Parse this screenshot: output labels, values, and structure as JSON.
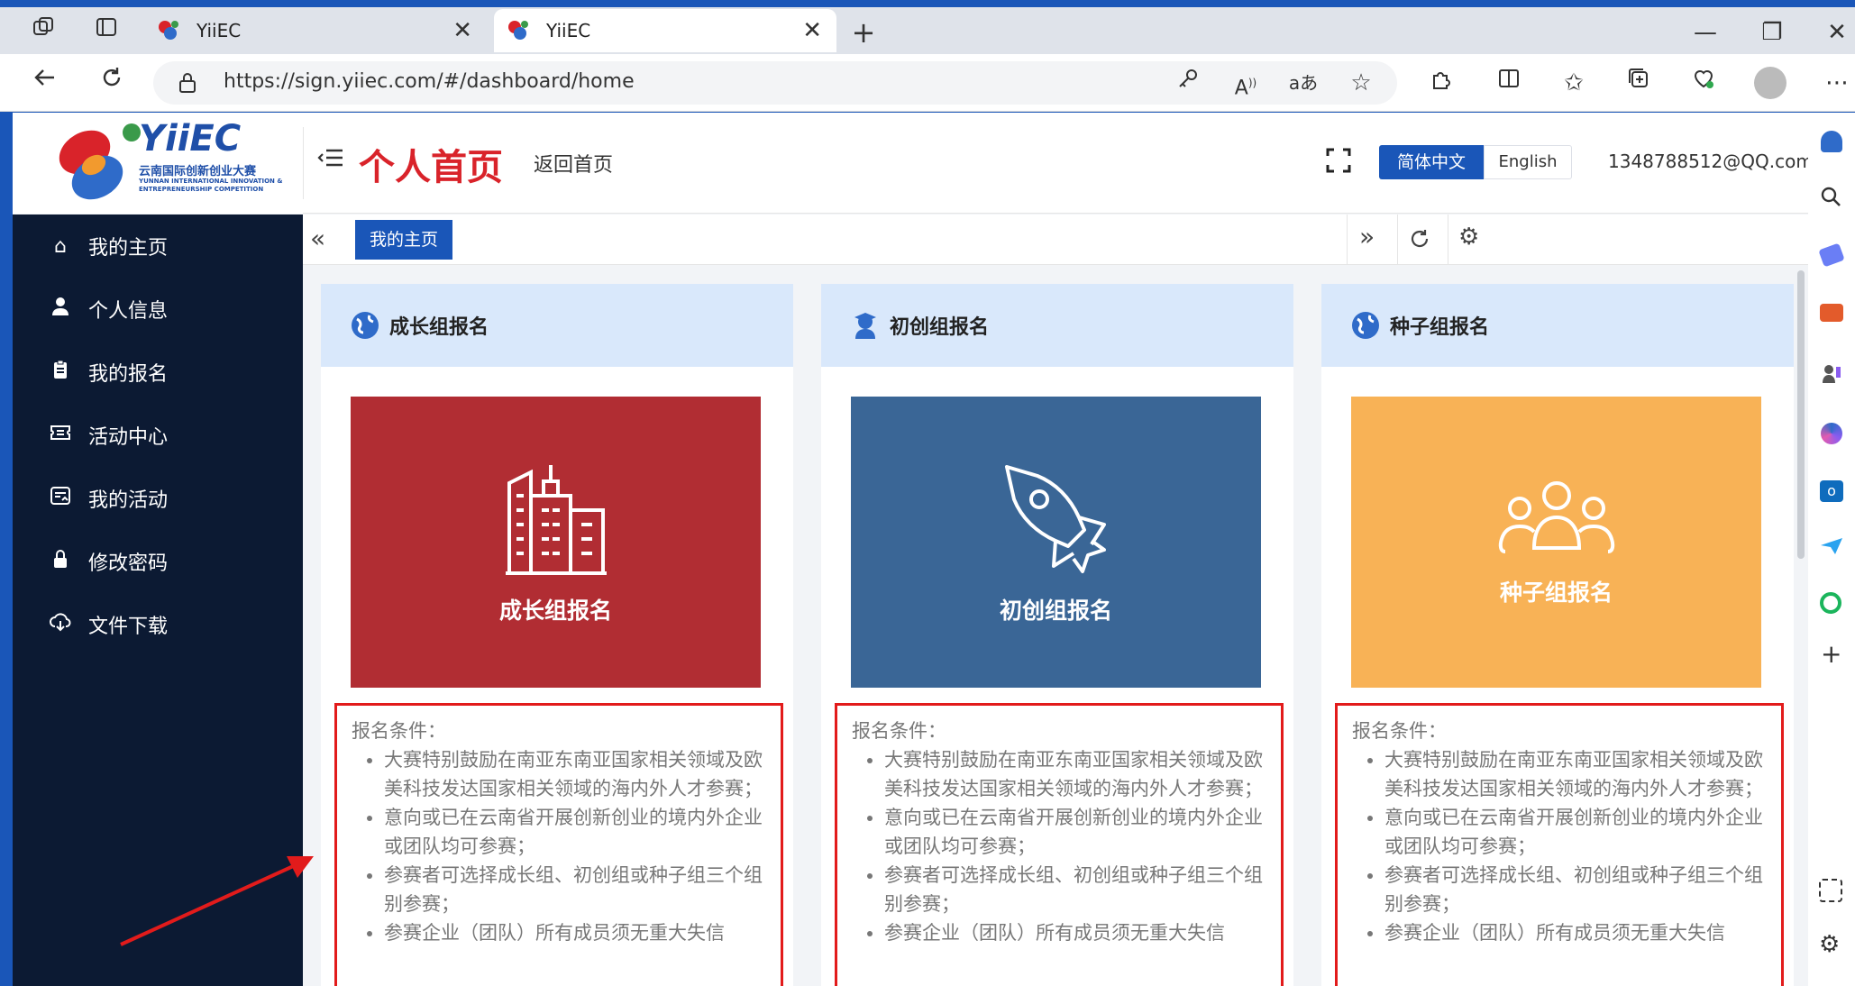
{
  "browser": {
    "tabs": [
      {
        "title": "YiiEC"
      },
      {
        "title": "YiiEC"
      }
    ],
    "close_glyph": "✕",
    "new_tab_glyph": "+",
    "url": "https://sign.yiiec.com/#/dashboard/home",
    "window_controls": [
      "—",
      "❐",
      "✕"
    ]
  },
  "header": {
    "logo_brand": "YiiEC",
    "logo_cn": "云南国际创新创业大赛",
    "logo_en": "YUNNAN INTERNATIONAL INNOVATION & ENTREPRENEURSHIP COMPETITION",
    "page_title": "个人首页",
    "back_home": "返回首页",
    "lang_zh": "简体中文",
    "lang_en": "English",
    "user_email": "1348788512@QQ.com"
  },
  "sidebar": {
    "items": [
      {
        "label": "我的主页",
        "icon": "home-icon"
      },
      {
        "label": "个人信息",
        "icon": "user-icon"
      },
      {
        "label": "我的报名",
        "icon": "form-icon"
      },
      {
        "label": "活动中心",
        "icon": "ticket-icon"
      },
      {
        "label": "我的活动",
        "icon": "activity-icon"
      },
      {
        "label": "修改密码",
        "icon": "lock-icon"
      },
      {
        "label": "文件下载",
        "icon": "cloud-download-icon"
      }
    ]
  },
  "tabstrip": {
    "active_tab": "我的主页"
  },
  "cards": [
    {
      "header": "成长组报名",
      "image_label": "成长组报名",
      "color": "#b12d33",
      "icon": "building-icon",
      "conditions_title": "报名条件：",
      "conditions": [
        "大赛特别鼓励在南亚东南亚国家相关领域及欧美科技发达国家相关领域的海内外人才参赛；",
        "意向或已在云南省开展创新创业的境内外企业或团队均可参赛；",
        "参赛者可选择成长组、初创组或种子组三个组别参赛；",
        "参赛企业（团队）所有成员须无重大失信"
      ]
    },
    {
      "header": "初创组报名",
      "image_label": "初创组报名",
      "color": "#3a6696",
      "icon": "rocket-icon",
      "conditions_title": "报名条件：",
      "conditions": [
        "大赛特别鼓励在南亚东南亚国家相关领域及欧美科技发达国家相关领域的海内外人才参赛；",
        "意向或已在云南省开展创新创业的境内外企业或团队均可参赛；",
        "参赛者可选择成长组、初创组或种子组三个组别参赛；",
        "参赛企业（团队）所有成员须无重大失信"
      ]
    },
    {
      "header": "种子组报名",
      "image_label": "种子组报名",
      "color": "#f8b256",
      "icon": "people-icon",
      "conditions_title": "报名条件：",
      "conditions": [
        "大赛特别鼓励在南亚东南亚国家相关领域及欧美科技发达国家相关领域的海内外人才参赛；",
        "意向或已在云南省开展创新创业的境内外企业或团队均可参赛；",
        "参赛者可选择成长组、初创组或种子组三个组别参赛；",
        "参赛企业（团队）所有成员须无重大失信"
      ]
    }
  ],
  "colors": {
    "sidebar_bg": "#0c1a33",
    "title_red": "#d9232a",
    "primary_blue": "#1a56b8",
    "card_header_bg": "#d9e8fb",
    "highlight_red": "#e21b1b"
  }
}
